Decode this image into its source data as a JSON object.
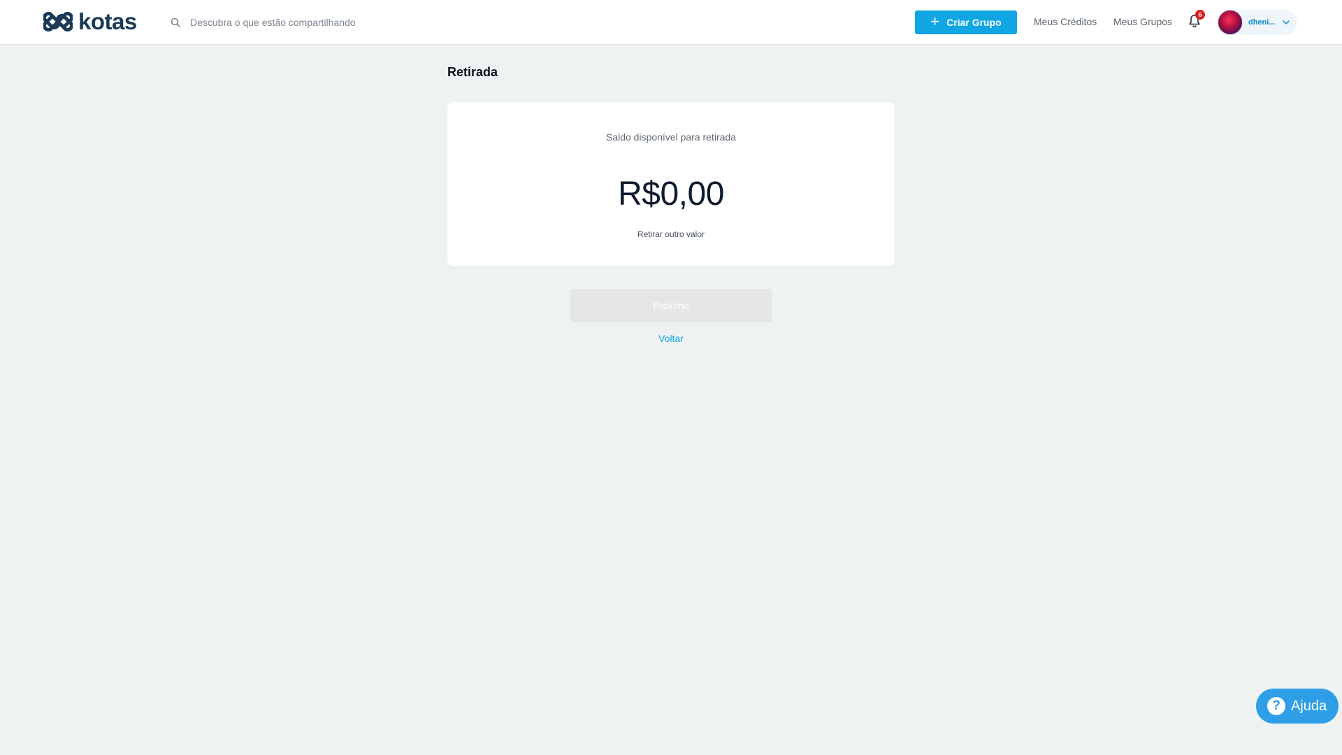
{
  "header": {
    "brand": "kotas",
    "search_placeholder": "Descubra o que estão compartilhando",
    "create_button": "Criar Grupo",
    "nav": {
      "credits": "Meus Créditos",
      "groups": "Meus Grupos"
    },
    "notifications_count": "6",
    "user_name": "dheni..."
  },
  "main": {
    "title": "Retirada",
    "balance_label": "Saldo disponível para retirada",
    "balance_amount": "R$0,00",
    "other_amount_link": "Retirar outro valor",
    "next_button": "Próximo",
    "back_link": "Voltar"
  },
  "help": {
    "label": "Ajuda",
    "icon_glyph": "?"
  },
  "colors": {
    "brand": "#1b3a57",
    "accent": "#0fa6e3",
    "badge": "#e21b1b",
    "background": "#eff2f3",
    "disabled": "#e6e6e6"
  }
}
